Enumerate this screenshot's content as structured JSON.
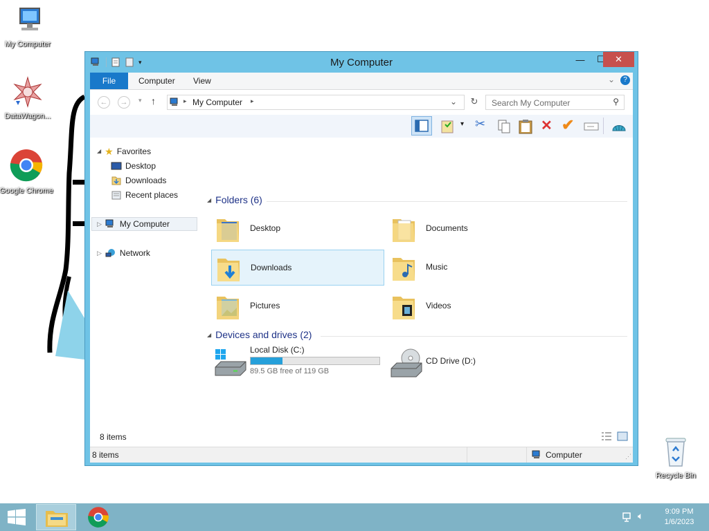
{
  "desktop": {
    "icons": [
      {
        "label": "My Computer"
      },
      {
        "label": "DataWagon..."
      },
      {
        "label": "Google Chrome"
      },
      {
        "label": "Recycle Bin"
      }
    ]
  },
  "window": {
    "title": "My Computer",
    "tabs": {
      "file": "File",
      "computer": "Computer",
      "view": "View"
    },
    "address": {
      "segment": "My Computer"
    },
    "search": {
      "placeholder": "Search My Computer"
    },
    "nav": {
      "favorites": "Favorites",
      "desktop": "Desktop",
      "downloads": "Downloads",
      "recent": "Recent places",
      "my_computer": "My Computer",
      "network": "Network"
    },
    "folders_header": "Folders (6)",
    "folders": [
      "Desktop",
      "Documents",
      "Downloads",
      "Music",
      "Pictures",
      "Videos"
    ],
    "drives_header": "Devices and drives (2)",
    "drives": [
      {
        "name": "Local Disk (C:)",
        "free_text": "89.5 GB free of 119 GB",
        "used_fraction": 0.248
      },
      {
        "name": "CD Drive (D:)"
      }
    ],
    "item_count": "8 items",
    "status": {
      "left": "8 items",
      "right": "Computer"
    }
  },
  "taskbar": {
    "time": "9:09 PM",
    "date": "1/6/2023"
  },
  "colors": {
    "window_frame": "#6fc3e6",
    "file_tab": "#1979ca",
    "close_button": "#c7504d",
    "disk_bar": "#26a0da",
    "taskbar": "#7fb3c6"
  }
}
